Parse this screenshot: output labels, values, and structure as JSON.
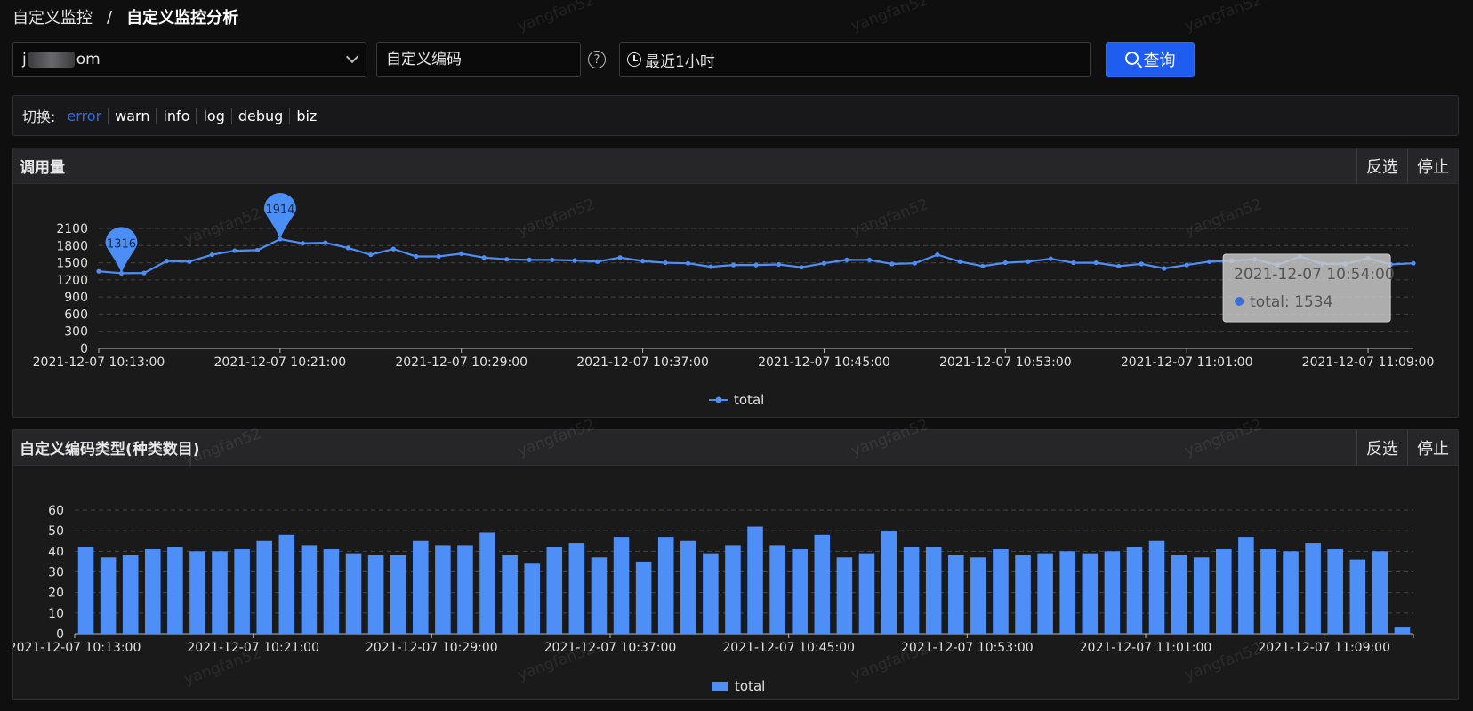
{
  "breadcrumb": {
    "parent": "自定义监控",
    "separator": "/",
    "current": "自定义监控分析"
  },
  "toolbar": {
    "app_prefix": "j",
    "app_suffix": "om",
    "code_placeholder": "自定义编码",
    "help_glyph": "?",
    "time_range": "最近1小时",
    "query_label": "查询"
  },
  "switch_bar": {
    "label": "切换:",
    "options": [
      "error",
      "warn",
      "info",
      "log",
      "debug",
      "biz"
    ],
    "active": "error"
  },
  "panels": {
    "call_volume": {
      "title": "调用量",
      "invert": "反选",
      "stop": "停止"
    },
    "code_types": {
      "title": "自定义编码类型(种类数目)",
      "invert": "反选",
      "stop": "停止"
    }
  },
  "watermark": "yangfan52",
  "colors": {
    "accent": "#1f5cf0",
    "series": "#4d8ef7",
    "active_tab": "#2a6bff"
  },
  "chart_data": [
    {
      "type": "line",
      "title": "调用量",
      "x_tick_labels": [
        "2021-12-07 10:13:00",
        "2021-12-07 10:21:00",
        "2021-12-07 10:29:00",
        "2021-12-07 10:37:00",
        "2021-12-07 10:45:00",
        "2021-12-07 10:53:00",
        "2021-12-07 11:01:00",
        "2021-12-07 11:09:00"
      ],
      "ylim": [
        0,
        2100
      ],
      "yticks": [
        0,
        300,
        600,
        900,
        1200,
        1500,
        1800,
        2100
      ],
      "grid": true,
      "legend": "bottom-center",
      "series": [
        {
          "name": "total",
          "values": [
            1350,
            1316,
            1320,
            1530,
            1520,
            1640,
            1710,
            1720,
            1914,
            1840,
            1850,
            1760,
            1640,
            1740,
            1610,
            1610,
            1660,
            1590,
            1560,
            1550,
            1550,
            1540,
            1520,
            1590,
            1530,
            1500,
            1490,
            1430,
            1460,
            1460,
            1470,
            1420,
            1490,
            1550,
            1550,
            1480,
            1490,
            1640,
            1520,
            1440,
            1500,
            1520,
            1570,
            1500,
            1500,
            1440,
            1480,
            1400,
            1460,
            1520,
            1534,
            1560,
            1460,
            1610,
            1480,
            1480,
            1580,
            1470,
            1490
          ]
        }
      ],
      "markers": [
        {
          "index": 1,
          "label": "1316"
        },
        {
          "index": 8,
          "label": "1914"
        }
      ],
      "tooltip": {
        "index": 50,
        "time": "2021-12-07 10:54:00",
        "series": "total",
        "value": 1534,
        "text": "total: 1534"
      }
    },
    {
      "type": "bar",
      "title": "自定义编码类型(种类数目)",
      "x_tick_labels": [
        "2021-12-07 10:13:00",
        "2021-12-07 10:21:00",
        "2021-12-07 10:29:00",
        "2021-12-07 10:37:00",
        "2021-12-07 10:45:00",
        "2021-12-07 10:53:00",
        "2021-12-07 11:01:00",
        "2021-12-07 11:09:00"
      ],
      "ylim": [
        0,
        60
      ],
      "yticks": [
        0,
        10,
        20,
        30,
        40,
        50,
        60
      ],
      "grid": true,
      "legend": "bottom-center",
      "series": [
        {
          "name": "total",
          "values": [
            42,
            37,
            38,
            41,
            42,
            40,
            40,
            41,
            45,
            48,
            43,
            41,
            39,
            38,
            38,
            45,
            43,
            43,
            49,
            38,
            34,
            42,
            44,
            37,
            47,
            35,
            47,
            45,
            39,
            43,
            52,
            43,
            41,
            48,
            37,
            39,
            50,
            42,
            42,
            38,
            37,
            41,
            38,
            39,
            40,
            39,
            40,
            42,
            45,
            38,
            37,
            41,
            47,
            41,
            40,
            44,
            41,
            36,
            40,
            3
          ]
        }
      ]
    }
  ]
}
